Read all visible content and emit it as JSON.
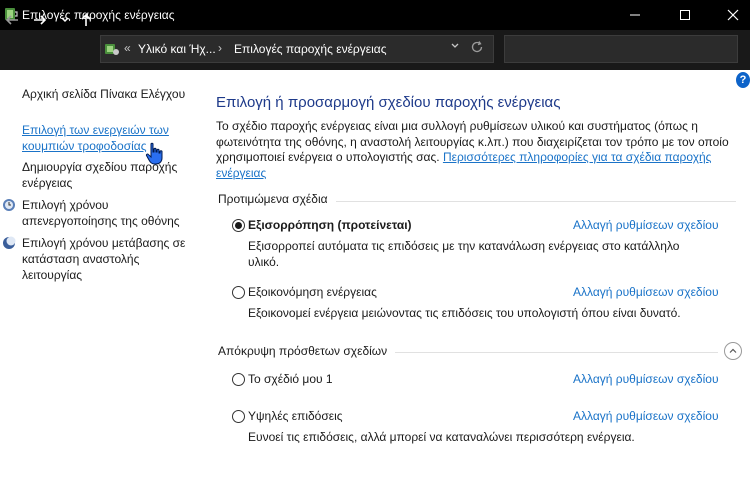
{
  "window": {
    "title": "Επιλογές παροχής ενέργειας"
  },
  "nav": {
    "address_chevrons": "«",
    "address_segment_1": "Υλικό και Ήχ...",
    "address_separator": "›",
    "address_segment_2": "Επιλογές παροχής ενέργειας",
    "search_placeholder": ""
  },
  "sidebar": {
    "home": "Αρχική σελίδα Πίνακα Ελέγχου",
    "buttons": "Επιλογή των ενεργειών των κουμπιών τροφοδοσίας",
    "create": "Δημιουργία σχεδίου παροχής ενέργειας",
    "display": "Επιλογή χρόνου απενεργοποίησης της οθόνης",
    "sleep": "Επιλογή χρόνου μετάβασης σε κατάσταση αναστολής λειτουργίας"
  },
  "main": {
    "heading": "Επιλογή ή προσαρμογή σχεδίου παροχής ενέργειας",
    "description": "Το σχέδιο παροχής ενέργειας είναι μια συλλογή ρυθμίσεων υλικού και συστήματος (όπως η φωτεινότητα της οθόνης, η αναστολή λειτουργίας κ.λπ.) που διαχειρίζεται τον τρόπο με τον οποίο χρησιμοποιεί ενέργεια ο υπολογιστής σας.",
    "description_link": "Περισσότερες πληροφορίες για τα σχέδια παροχής ενέργειας",
    "preferred_header": "Προτιμώμενα σχέδια",
    "hidden_header": "Απόκρυψη πρόσθετων σχεδίων",
    "change_label": "Αλλαγή ρυθμίσεων σχεδίου",
    "plans": [
      {
        "name": "Εξισορρόπηση (προτείνεται)",
        "selected": true,
        "description": "Εξισορροπεί αυτόματα τις επιδόσεις με την κατανάλωση ενέργειας στο κατάλληλο υλικό."
      },
      {
        "name": "Εξοικονόμηση ενέργειας",
        "selected": false,
        "description": "Εξοικονομεί ενέργεια μειώνοντας τις επιδόσεις του υπολογιστή όπου είναι δυνατό."
      },
      {
        "name": "Το σχέδιό μου 1",
        "selected": false,
        "description": ""
      },
      {
        "name": "Υψηλές επιδόσεις",
        "selected": false,
        "description": "Ευνοεί τις επιδόσεις, αλλά μπορεί να καταναλώνει περισσότερη ενέργεια."
      }
    ]
  },
  "colors": {
    "titlebar": "#000000",
    "navbar": "#191919",
    "link": "#1a73c8",
    "heading": "#1e3a8a"
  }
}
